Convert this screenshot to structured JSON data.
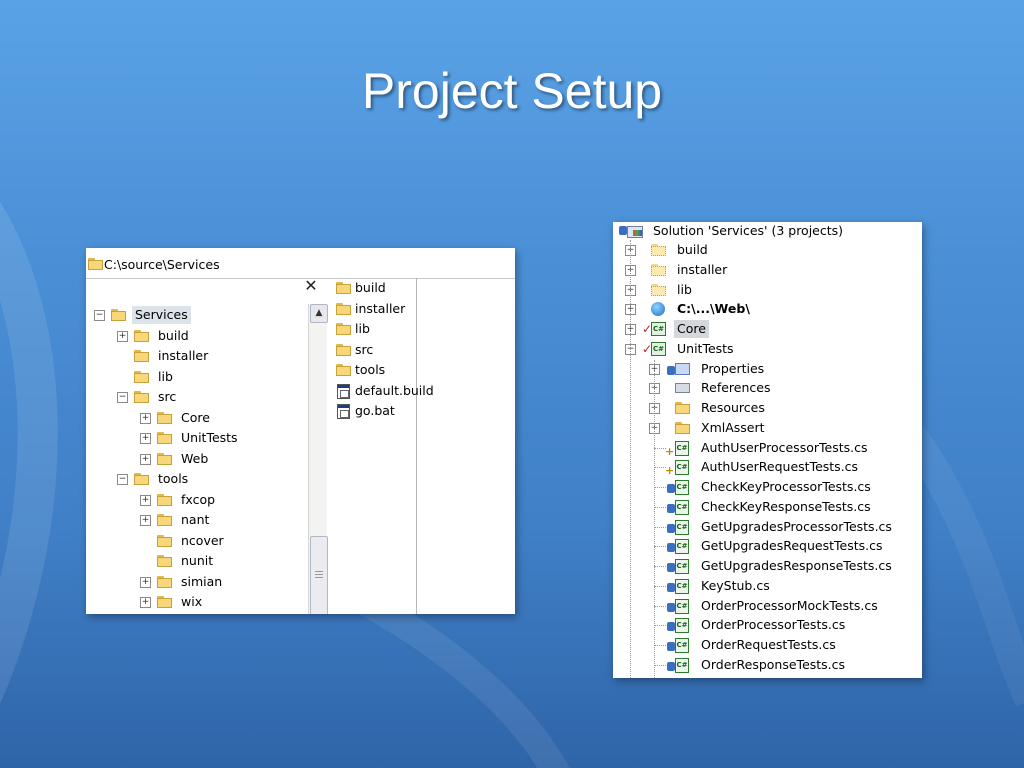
{
  "slide": {
    "title": "Project Setup"
  },
  "explorer": {
    "address": "C:\\source\\Services",
    "close_glyph": "✕",
    "tree": [
      {
        "label": "Services",
        "expander": "−",
        "indent": 0,
        "selected": true
      },
      {
        "label": "build",
        "expander": "+",
        "indent": 1
      },
      {
        "label": "installer",
        "expander": "",
        "indent": 1
      },
      {
        "label": "lib",
        "expander": "",
        "indent": 1
      },
      {
        "label": "src",
        "expander": "−",
        "indent": 1
      },
      {
        "label": "Core",
        "expander": "+",
        "indent": 2
      },
      {
        "label": "UnitTests",
        "expander": "+",
        "indent": 2
      },
      {
        "label": "Web",
        "expander": "+",
        "indent": 2
      },
      {
        "label": "tools",
        "expander": "−",
        "indent": 1
      },
      {
        "label": "fxcop",
        "expander": "+",
        "indent": 2
      },
      {
        "label": "nant",
        "expander": "+",
        "indent": 2
      },
      {
        "label": "ncover",
        "expander": "",
        "indent": 2
      },
      {
        "label": "nunit",
        "expander": "",
        "indent": 2
      },
      {
        "label": "simian",
        "expander": "+",
        "indent": 2
      },
      {
        "label": "wix",
        "expander": "+",
        "indent": 2
      }
    ],
    "contents": [
      {
        "label": "build",
        "icon": "folder-icon"
      },
      {
        "label": "installer",
        "icon": "folder-icon"
      },
      {
        "label": "lib",
        "icon": "folder-icon"
      },
      {
        "label": "src",
        "icon": "folder-icon"
      },
      {
        "label": "tools",
        "icon": "folder-icon"
      },
      {
        "label": "default.build",
        "icon": "build-file-icon"
      },
      {
        "label": "go.bat",
        "icon": "batch-file-icon"
      }
    ]
  },
  "solution": {
    "header": "Solution 'Services' (3 projects)",
    "items": [
      {
        "label": "build",
        "kind": "folder-light",
        "expander": "+",
        "level": 1
      },
      {
        "label": "installer",
        "kind": "folder-light",
        "expander": "+",
        "level": 1
      },
      {
        "label": "lib",
        "kind": "folder-light",
        "expander": "+",
        "level": 1
      },
      {
        "label": "C:\\...\\Web\\",
        "kind": "web-project",
        "expander": "+",
        "level": 1,
        "bold": true
      },
      {
        "label": "Core",
        "kind": "project",
        "expander": "+",
        "level": 1,
        "selected": true
      },
      {
        "label": "UnitTests",
        "kind": "project",
        "expander": "−",
        "level": 1
      },
      {
        "label": "Properties",
        "kind": "properties",
        "expander": "+",
        "level": 2
      },
      {
        "label": "References",
        "kind": "references",
        "expander": "+",
        "level": 2
      },
      {
        "label": "Resources",
        "kind": "folder",
        "expander": "+",
        "level": 2
      },
      {
        "label": "XmlAssert",
        "kind": "folder",
        "expander": "+",
        "level": 2
      },
      {
        "label": "AuthUserProcessorTests.cs",
        "kind": "cs-add",
        "level": 2
      },
      {
        "label": "AuthUserRequestTests.cs",
        "kind": "cs-add",
        "level": 2
      },
      {
        "label": "CheckKeyProcessorTests.cs",
        "kind": "cs-lock",
        "level": 2
      },
      {
        "label": "CheckKeyResponseTests.cs",
        "kind": "cs-lock",
        "level": 2
      },
      {
        "label": "GetUpgradesProcessorTests.cs",
        "kind": "cs-lock",
        "level": 2
      },
      {
        "label": "GetUpgradesRequestTests.cs",
        "kind": "cs-lock",
        "level": 2
      },
      {
        "label": "GetUpgradesResponseTests.cs",
        "kind": "cs-lock",
        "level": 2
      },
      {
        "label": "KeyStub.cs",
        "kind": "cs-lock",
        "level": 2
      },
      {
        "label": "OrderProcessorMockTests.cs",
        "kind": "cs-lock",
        "level": 2
      },
      {
        "label": "OrderProcessorTests.cs",
        "kind": "cs-lock",
        "level": 2
      },
      {
        "label": "OrderRequestTests.cs",
        "kind": "cs-lock",
        "level": 2
      },
      {
        "label": "OrderResponseTests.cs",
        "kind": "cs-lock",
        "level": 2
      }
    ]
  },
  "colors": {
    "background_top": "#5aa2e6",
    "background_bottom": "#2f64a8",
    "title": "#ffffff"
  }
}
